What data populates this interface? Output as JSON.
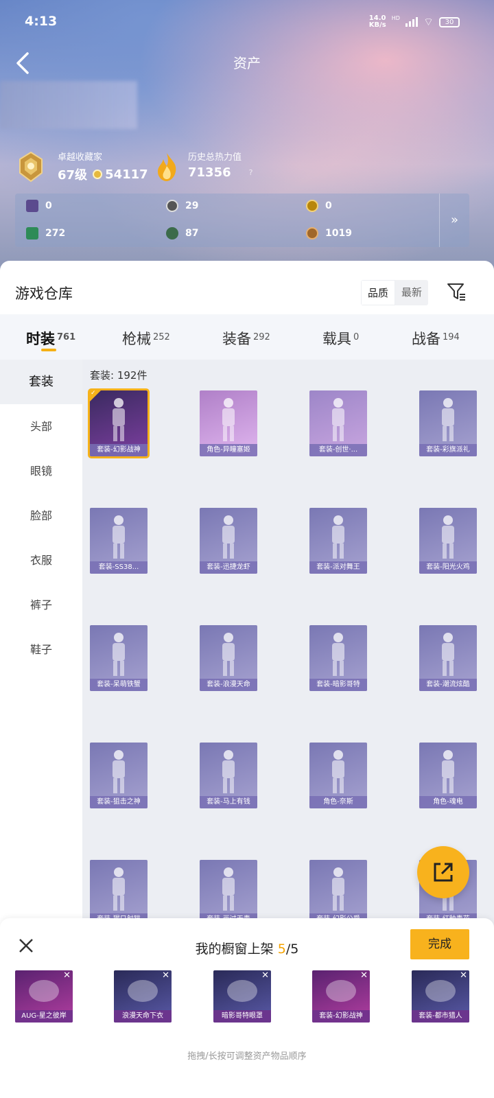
{
  "status_bar": {
    "time": "4:13",
    "net_speed": "14.0",
    "net_unit": "KB/s",
    "hd": "HD",
    "battery": "30"
  },
  "header": {
    "title": "资产"
  },
  "stats": {
    "collector": {
      "label": "卓越收藏家",
      "level": "67级",
      "points": "54117"
    },
    "heat": {
      "label": "历史总热力值",
      "value": "71356",
      "help": "?"
    }
  },
  "currencies": [
    {
      "value": "0",
      "color": "#5b4a8e"
    },
    {
      "value": "29",
      "color": "#555"
    },
    {
      "value": "0",
      "color": "#b8860b"
    },
    {
      "value": "272",
      "color": "#2e8b57"
    },
    {
      "value": "87",
      "color": "#3c6b4a"
    },
    {
      "value": "1019",
      "color": "#a0672a"
    }
  ],
  "more_chevron": "»",
  "warehouse": {
    "title": "游戏仓库",
    "sort_quality": "品质",
    "sort_newest": "最新"
  },
  "tabs": [
    {
      "label": "时装",
      "count": "761"
    },
    {
      "label": "枪械",
      "count": "252"
    },
    {
      "label": "装备",
      "count": "292"
    },
    {
      "label": "载具",
      "count": "0"
    },
    {
      "label": "战备",
      "count": "194"
    }
  ],
  "sidebar": [
    "套装",
    "头部",
    "眼镜",
    "脸部",
    "衣服",
    "裤子",
    "鞋子"
  ],
  "grid": {
    "count_label": "套装: 192件",
    "items": [
      "套装-幻影战神",
      "角色-异瞳塞姬",
      "套装-创世·...",
      "套装-彩旗派礼",
      "套装-SS38...",
      "套装-迅捷龙虾",
      "套装-派对舞王",
      "套装-阳光火鸡",
      "套装-呆萌铁蟹",
      "套装-浪漫天命",
      "套装-暗影哥特",
      "套装-潮流炫酷",
      "套装-狙击之神",
      "套装-马上有钱",
      "角色-奈斯",
      "角色-魂电",
      "套装-猩只射猫",
      "套装-画过天青",
      "套装-幻影公爵",
      "套装-红釉青花"
    ]
  },
  "drawer": {
    "title_prefix": "我的橱窗上架 ",
    "current": "5",
    "total": "/5",
    "done_label": "完成",
    "shelf_items": [
      "AUG-星之彼岸",
      "浪漫天命下衣",
      "暗影哥特眼罩",
      "套装-幻影战神",
      "套装-都市猎人"
    ],
    "remove_icon": "✕",
    "hint": "拖拽/长按可调整资产物品顺序"
  },
  "colors": {
    "accent": "#f8b21d",
    "card_purple": "#7d72b8",
    "card_pink": "#c98fd6"
  }
}
